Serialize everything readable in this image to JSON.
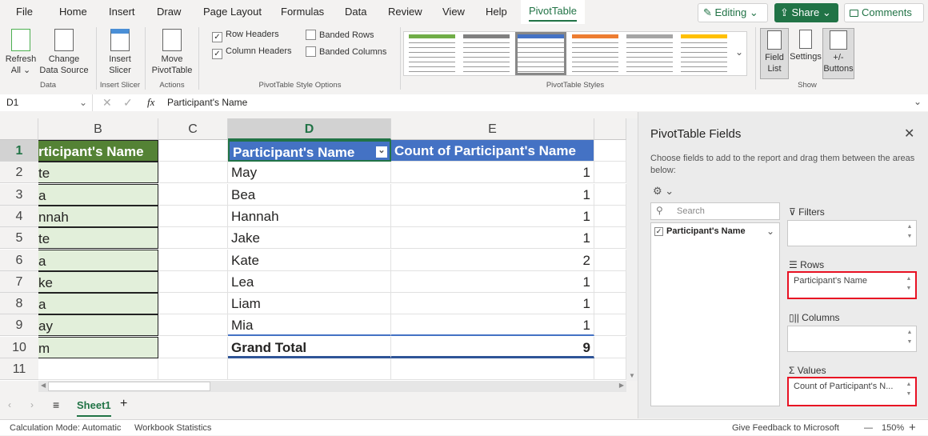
{
  "tabs": [
    "File",
    "Home",
    "Insert",
    "Draw",
    "Page Layout",
    "Formulas",
    "Data",
    "Review",
    "View",
    "Help",
    "PivotTable"
  ],
  "top_buttons": {
    "editing": "Editing",
    "share": "Share",
    "comments": "Comments"
  },
  "ribbon": {
    "refresh": "Refresh All",
    "change_source": "Change Data Source",
    "group_data": "Data",
    "insert_slicer": "Insert Slicer",
    "group_slicer": "Insert Slicer",
    "move_pivot": "Move PivotTable",
    "group_actions": "Actions",
    "row_headers": "Row Headers",
    "column_headers": "Column Headers",
    "banded_rows": "Banded Rows",
    "banded_columns": "Banded Columns",
    "group_style_options": "PivotTable Style Options",
    "group_styles": "PivotTable Styles",
    "field_list": "Field List",
    "settings": "Settings",
    "plus_minus": "+/- Buttons",
    "group_show": "Show",
    "style_colors": [
      "#70ad47",
      "#808080",
      "#4472c4",
      "#ed7d31",
      "#a5a5a5",
      "#ffc000"
    ]
  },
  "formula_bar": {
    "name_box": "D1",
    "fx": "fx",
    "value": "Participant's Name"
  },
  "columns": [
    "B",
    "C",
    "D",
    "E"
  ],
  "rows": [
    "1",
    "2",
    "3",
    "4",
    "5",
    "6",
    "7",
    "8",
    "9",
    "10",
    "11"
  ],
  "source_col": [
    "rticipant's Name",
    "te",
    "a",
    "nnah",
    "te",
    "a",
    "ke",
    "a",
    "ay",
    "m"
  ],
  "pivot": {
    "header_row": "Participant's Name",
    "header_value": "Count of Participant's Name",
    "rows": [
      {
        "name": "May",
        "count": "1"
      },
      {
        "name": "Bea",
        "count": "1"
      },
      {
        "name": "Hannah",
        "count": "1"
      },
      {
        "name": "Jake",
        "count": "1"
      },
      {
        "name": "Kate",
        "count": "2"
      },
      {
        "name": "Lea",
        "count": "1"
      },
      {
        "name": "Liam",
        "count": "1"
      },
      {
        "name": "Mia",
        "count": "1"
      }
    ],
    "total_label": "Grand Total",
    "total": "9"
  },
  "sheet_tab": "Sheet1",
  "field_pane": {
    "title": "PivotTable Fields",
    "desc": "Choose fields to add to the report and drag them between the areas below:",
    "search": "Search",
    "field": "Participant's Name",
    "filters": "Filters",
    "rows": "Rows",
    "rows_item": "Participant's Name",
    "columns": "Columns",
    "values": "Values",
    "values_item": "Count of Participant's N..."
  },
  "status": {
    "calc": "Calculation Mode: Automatic",
    "stats": "Workbook Statistics",
    "feedback": "Give Feedback to Microsoft",
    "zoom": "150%"
  }
}
